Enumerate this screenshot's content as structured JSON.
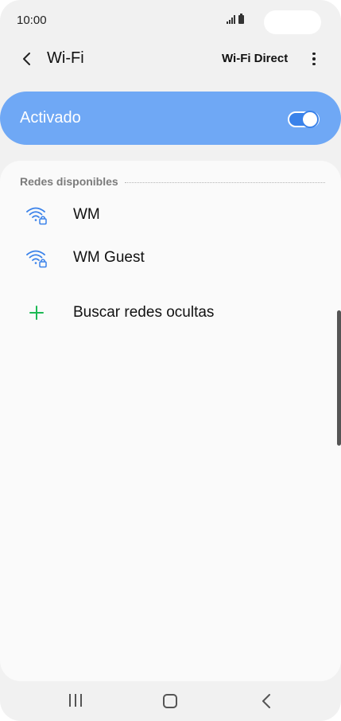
{
  "status_bar": {
    "time": "10:00",
    "icons": [
      "signal-icon",
      "battery-icon"
    ]
  },
  "header": {
    "title": "Wi-Fi",
    "wifi_direct_label": "Wi-Fi Direct",
    "back_icon": "chevron-left-icon",
    "more_icon": "more-vert-icon"
  },
  "master_switch": {
    "label": "Activado",
    "on": true
  },
  "available_networks": {
    "section_title": "Redes disponibles",
    "networks": [
      {
        "name": "WM",
        "icon": "wifi-lock-icon",
        "secured": true
      },
      {
        "name": "WM Guest",
        "icon": "wifi-lock-icon",
        "secured": true
      }
    ]
  },
  "add_hidden": {
    "label": "Buscar redes ocultas",
    "icon": "plus-icon"
  },
  "nav_bar": {
    "icons": [
      "recents-icon",
      "home-icon",
      "back-icon"
    ]
  },
  "colors": {
    "accent": "#3a82ea",
    "switch_bg": "#6fa8f5",
    "wifi_icon": "#3a82ea",
    "plus_icon": "#1db954"
  }
}
